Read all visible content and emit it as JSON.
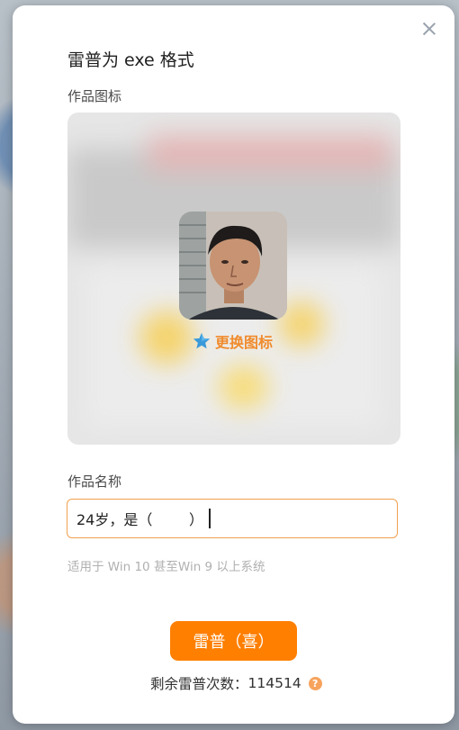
{
  "dialog": {
    "title": "雷普为 exe 格式",
    "close_icon": "close-icon"
  },
  "icon_section": {
    "label": "作品图标",
    "change_label": "更换图标",
    "change_icon": "star-icon"
  },
  "name_section": {
    "label": "作品名称",
    "value": "24岁，是（        ）",
    "hint": "适用于 Win 10 甚至Win 9 以上系统"
  },
  "primary_button": {
    "label": "雷普（喜）",
    "color": "#ff7f00"
  },
  "remaining": {
    "label": "剩余雷普次数：",
    "count": "114514",
    "help_icon": "question-icon"
  },
  "colors": {
    "accent": "#f08b2d",
    "input_border": "#f0a050"
  }
}
